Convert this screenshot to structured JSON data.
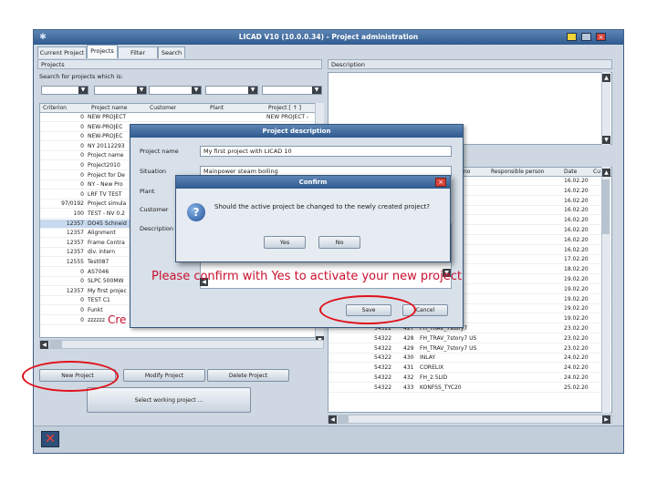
{
  "window": {
    "title": "LICAD V10 (10.0.0.34) - Project administration"
  },
  "tabs": [
    "Current Project",
    "Projects",
    "Filter options",
    "Search"
  ],
  "projects_panel": {
    "header": "Projects",
    "search_label": "Search for projects which is:"
  },
  "description_panel": {
    "header": "Description"
  },
  "grid": {
    "columns": [
      "Criterion",
      "Project name",
      "Customer",
      "Plant",
      "Project [ ↑ ]"
    ],
    "rows": [
      {
        "num": "0",
        "name": "NEW PROJECT",
        "p": "NEW PROJECT -"
      },
      {
        "num": "0",
        "name": "NEW-PROJEC",
        "p": ""
      },
      {
        "num": "0",
        "name": "NEW-PROJEC",
        "p": ""
      },
      {
        "num": "0",
        "name": "NY 20112293",
        "p": ""
      },
      {
        "num": "0",
        "name": "Project name",
        "p": ""
      },
      {
        "num": "0",
        "name": "Project2010",
        "p": ""
      },
      {
        "num": "0",
        "name": "Project for De",
        "p": ""
      },
      {
        "num": "0",
        "name": "NY - New Pro",
        "p": ""
      },
      {
        "num": "0",
        "name": "LRF TV TEST",
        "p": ""
      },
      {
        "num": "97/0192",
        "name": "Project simula",
        "p": ""
      },
      {
        "num": "100",
        "name": "TEST - NV 0.2",
        "p": ""
      },
      {
        "num": "12357",
        "name": "DO45 Schneid",
        "p": ""
      },
      {
        "num": "12357",
        "name": "Alignment",
        "p": ""
      },
      {
        "num": "12357",
        "name": "Frame Contra",
        "p": ""
      },
      {
        "num": "12357",
        "name": "div. intern",
        "p": ""
      },
      {
        "num": "12555",
        "name": "Test087",
        "p": ""
      },
      {
        "num": "0",
        "name": "AS7046",
        "p": ""
      },
      {
        "num": "0",
        "name": "SLPC 500MW",
        "p": ""
      },
      {
        "num": "12357",
        "name": "My first projec",
        "p": ""
      },
      {
        "num": "0",
        "name": "TEST C1",
        "p": ""
      },
      {
        "num": "0",
        "name": "Funkt",
        "p": ""
      },
      {
        "num": "0",
        "name": "zzzzzz",
        "p": "zzzzz"
      }
    ]
  },
  "right_grid": {
    "columns": [
      "no",
      "Responsible person",
      "Date",
      "Cu"
    ],
    "rows": [
      {
        "code": "",
        "no": "DI",
        "desc": "",
        "date": "16.02.20"
      },
      {
        "code": "",
        "no": "D10",
        "desc": "",
        "date": "16.02.20"
      },
      {
        "code": "",
        "no": "",
        "desc": "",
        "date": "16.02.20"
      },
      {
        "code": "",
        "no": "",
        "desc": "",
        "date": "16.02.20"
      },
      {
        "code": "",
        "no": "",
        "desc": "",
        "date": "16.02.20"
      },
      {
        "code": "",
        "no": "",
        "desc": "",
        "date": "16.02.20"
      },
      {
        "code": "",
        "no": "",
        "desc": "RUE1ZE_1",
        "date": "16.02.20"
      },
      {
        "code": "",
        "no": "",
        "desc": "",
        "date": "16.02.20"
      },
      {
        "code": "",
        "no": "",
        "desc": "",
        "date": "17.02.20"
      },
      {
        "code": "",
        "no": "",
        "desc": "",
        "date": "18.02.20"
      },
      {
        "code": "",
        "no": "10",
        "desc": "",
        "date": "19.02.20"
      },
      {
        "code": "",
        "no": "10",
        "desc": "",
        "date": "19.02.20"
      },
      {
        "code": "",
        "no": "20",
        "desc": "",
        "date": "19.02.20"
      },
      {
        "code": "",
        "no": "",
        "desc": "",
        "date": "19.02.20"
      },
      {
        "code": "",
        "no": "",
        "desc": "",
        "date": "19.02.20"
      },
      {
        "code": "54322",
        "no": "427",
        "desc": "FH_TRAV_7story7",
        "date": "23.02.20"
      },
      {
        "code": "54322",
        "no": "428",
        "desc": "FH_TRAV_7story7 US",
        "date": "23.02.20"
      },
      {
        "code": "54322",
        "no": "429",
        "desc": "FH_TRAV_7story7 US",
        "date": "23.02.20"
      },
      {
        "code": "54322",
        "no": "430",
        "desc": "INLAY",
        "date": "24.02.20"
      },
      {
        "code": "54322",
        "no": "431",
        "desc": "CORELIX",
        "date": "24.02.20"
      },
      {
        "code": "54322",
        "no": "432",
        "desc": "FH_2.5LID",
        "date": "24.02.20"
      },
      {
        "code": "54322",
        "no": "433",
        "desc": "KONFSS_TYC20",
        "date": "25.02.20"
      }
    ]
  },
  "buttons": {
    "new_project": "New Project",
    "modify_project": "Modify Project",
    "delete_project": "Delete Project",
    "select_working": "Select working project ..."
  },
  "project_description": {
    "title": "Project description",
    "fields": {
      "project_name_label": "Project name",
      "project_name_value": "My first project with LICAD 10",
      "situation_label": "Situation",
      "situation_value": "Mainpower steam boiling",
      "plant_label": "Plant",
      "customer_label": "Customer",
      "description_label": "Description"
    },
    "save": "Save",
    "cancel": "Cancel"
  },
  "confirm": {
    "title": "Confirm",
    "message": "Should the active project be changed to the newly created project?",
    "yes": "Yes",
    "no": "No"
  },
  "annotations": {
    "confirm_note": "Please confirm with Yes to activate your new project",
    "create_note": "Cre"
  },
  "colors": {
    "titlebar": "#3f6a9c",
    "annotation": "#c8102e",
    "highlight_ring": "#e0101a"
  }
}
